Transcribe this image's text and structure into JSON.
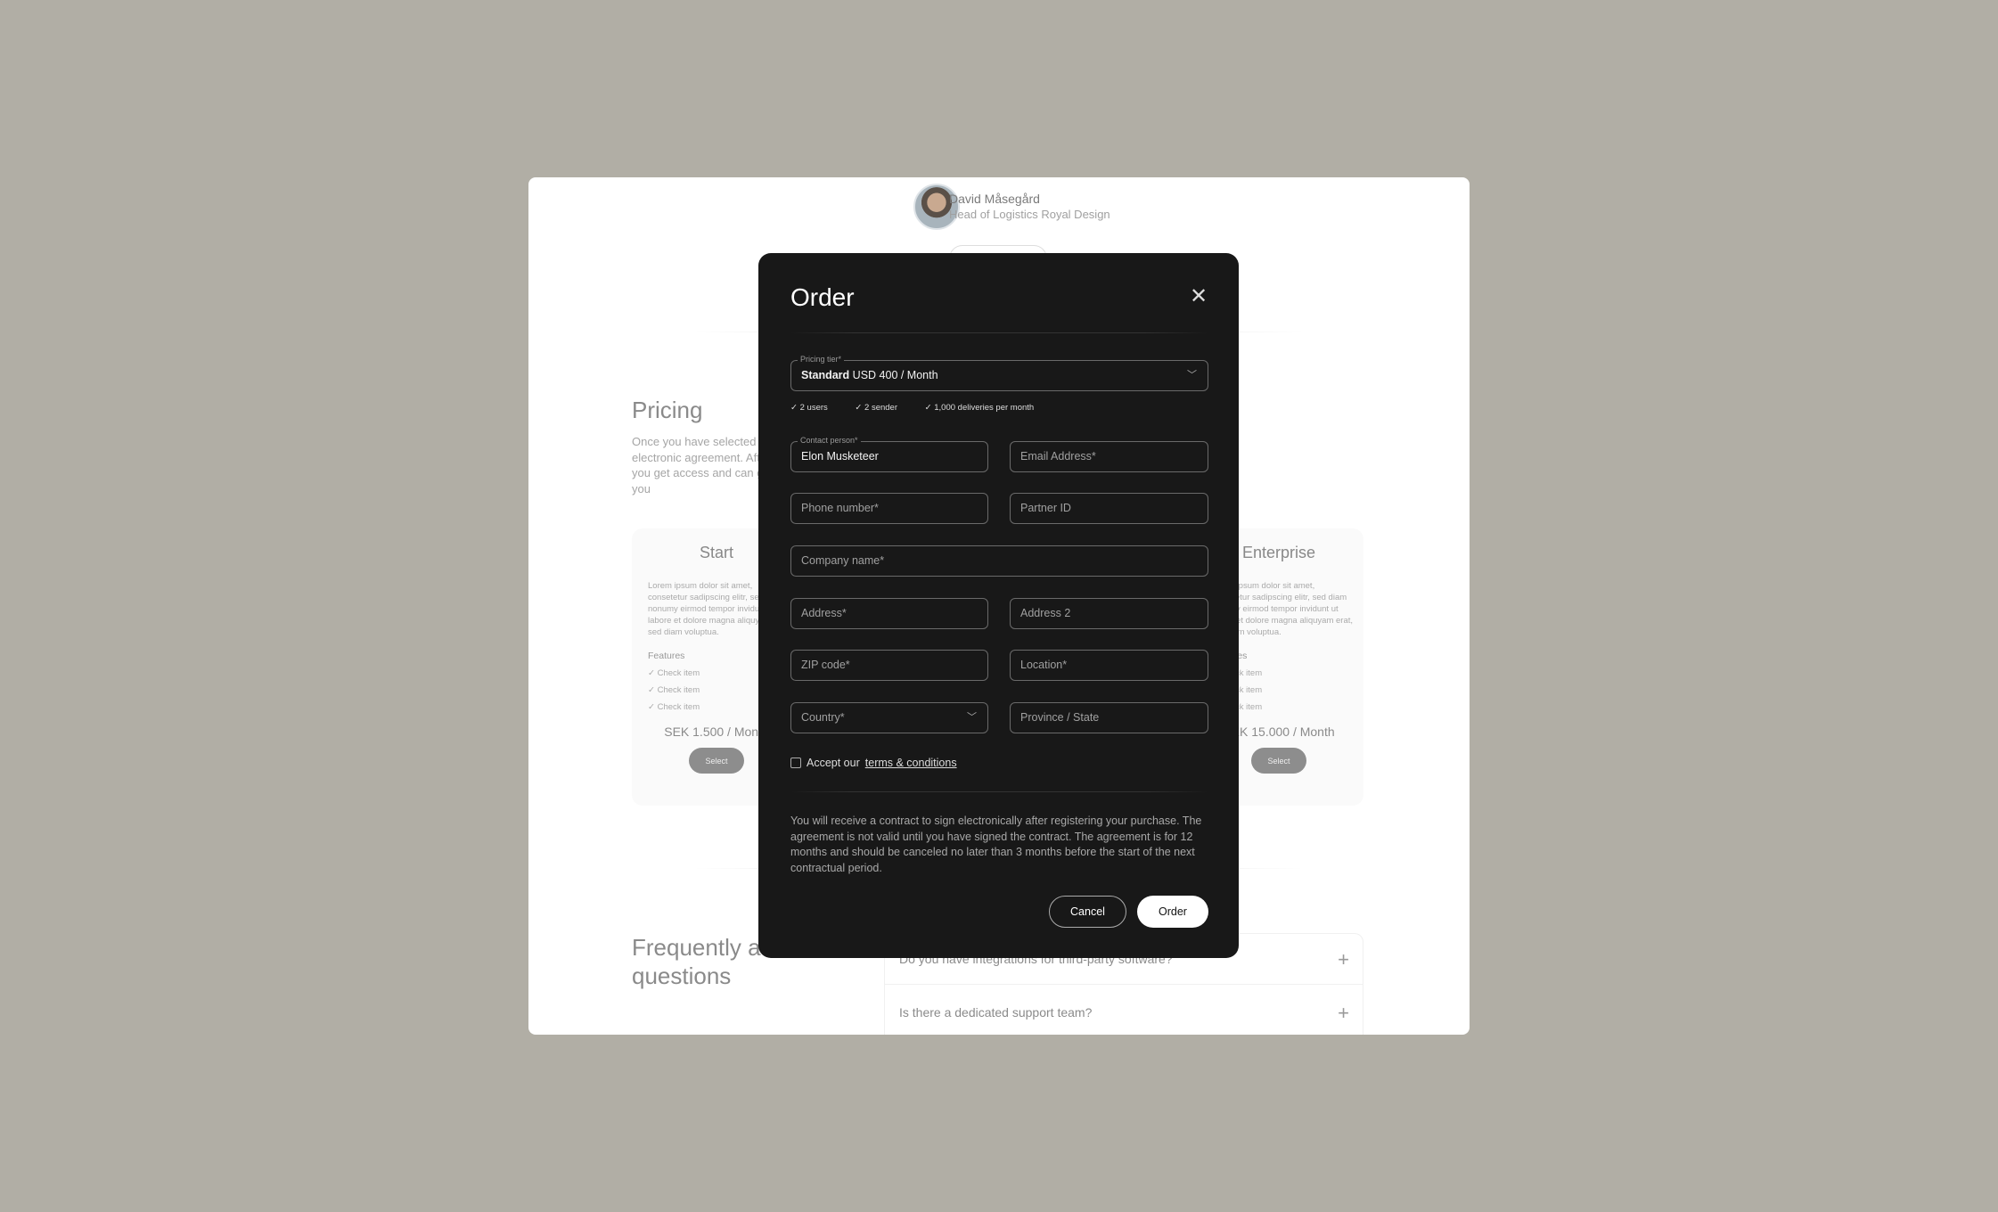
{
  "background": {
    "profile": {
      "name": "David Måsegård",
      "title": "Head of Logistics Royal Design"
    },
    "pricing": {
      "heading": "Pricing",
      "text": "Once you have selected a plan you will receive an electronic agreement. After signing the agreement, you get access and can get started. Within an hour you",
      "plans": [
        {
          "name": "Start",
          "description": "Lorem ipsum dolor sit amet, consetetur sadipscing elitr, sed diam nonumy eirmod tempor invidunt ut labore et dolore magna aliquyam erat, sed diam voluptua.",
          "features_label": "Features",
          "items": [
            "Check item",
            "Check item",
            "Check item"
          ],
          "price": "SEK 1.500 / Month",
          "button": "Select"
        },
        {
          "name": "Enterprise",
          "description": "Lorem ipsum dolor sit amet, consetetur sadipscing elitr, sed diam nonumy eirmod tempor invidunt ut labore et dolore magna aliquyam erat, sed diam voluptua.",
          "features_label": "Features",
          "items": [
            "Check item",
            "Check item",
            "Check item"
          ],
          "price": "SEK 15.000 / Month",
          "button": "Select"
        }
      ]
    },
    "faq": {
      "heading": "Frequently asked questions",
      "items": [
        "Do you have integrations for third-party software?",
        "Is there a dedicated support team?"
      ]
    }
  },
  "modal": {
    "title": "Order",
    "pricing_tier": {
      "label": "Pricing tier*",
      "value_bold": "Standard",
      "value": "USD 400 / Month"
    },
    "tier_features": [
      "2 users",
      "2 sender",
      "1,000 deliveries per month"
    ],
    "contact_person": {
      "label": "Contact person*",
      "value": "Elon Musketeer"
    },
    "placeholders": {
      "email": "Email Address*",
      "phone": "Phone number*",
      "partner": "Partner ID",
      "company": "Company name*",
      "address": "Address*",
      "address2": "Address 2",
      "zip": "ZIP code*",
      "location": "Location*",
      "country": "Country*",
      "province": "Province / State"
    },
    "accept_prefix": "Accept our",
    "terms_link": "terms & conditions",
    "note": "You will receive a contract to sign electronically after registering your purchase. The agreement is not valid until you have signed the contract. The agreement is for 12 months and should be canceled no later than 3 months before the start of the next contractual period.",
    "cancel": "Cancel",
    "order": "Order"
  }
}
